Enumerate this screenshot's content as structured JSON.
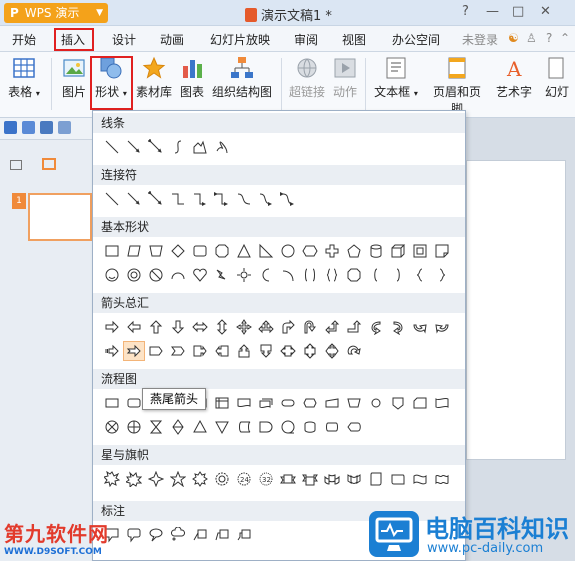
{
  "app": {
    "badge": "WPS 演示",
    "badge_letter": "P"
  },
  "document": {
    "title": "演示文稿1 *"
  },
  "window_controls": [
    "?",
    "—",
    "□",
    "✕"
  ],
  "menu": {
    "items": [
      "开始",
      "插入",
      "设计",
      "动画",
      "幻灯片放映",
      "审阅",
      "视图",
      "办公空间"
    ],
    "active": "插入",
    "login": "未登录"
  },
  "ribbon": {
    "table": "表格",
    "picture": "图片",
    "shape": "形状",
    "material": "素材库",
    "chart": "图表",
    "orgchart": "组织结构图",
    "hyperlink": "超链接",
    "action": "动作",
    "textbox": "文本框",
    "header_footer": "页眉和页脚",
    "wordart": "艺术字",
    "slide_more": "幻灯"
  },
  "dropdown": {
    "sections": [
      "线条",
      "连接符",
      "基本形状",
      "箭头总汇",
      "流程图",
      "星与旗帜",
      "标注"
    ]
  },
  "tooltip": "燕尾箭头",
  "slide_number": "1",
  "watermark_left": {
    "brand": "第九软件网",
    "url": "WWW.D9SOFT.COM"
  },
  "watermark_right": {
    "brand": "电脑百科知识",
    "url": "www.pc-daily.com"
  },
  "colors": {
    "highlight_border": "#e02020",
    "app_orange": "#f4a21a",
    "watermark_blue": "#1b7fd3",
    "watermark_red": "#e23b2c"
  }
}
